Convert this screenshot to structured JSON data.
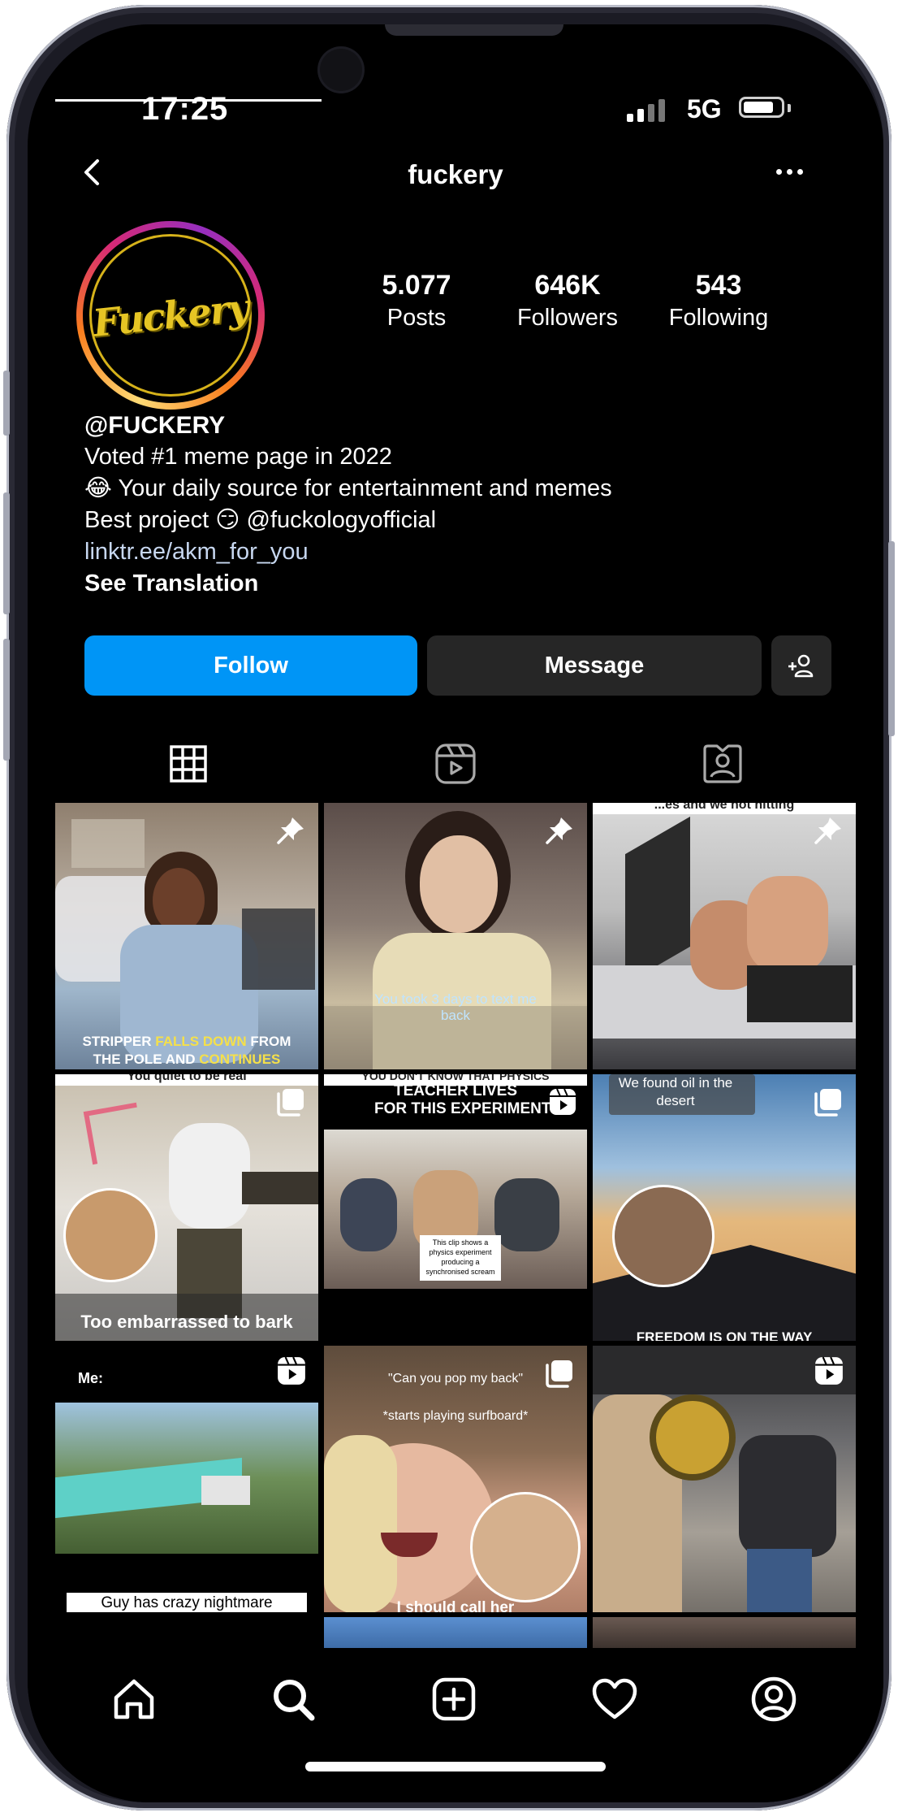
{
  "status_bar": {
    "time": "17:25",
    "network": "5G"
  },
  "header": {
    "username": "fuckery"
  },
  "profile": {
    "avatar_text": "Fuckery",
    "stats": [
      {
        "value": "5.077",
        "label": "Posts"
      },
      {
        "value": "646K",
        "label": "Followers"
      },
      {
        "value": "543",
        "label": "Following"
      }
    ],
    "display_name": "@FUCKERY",
    "bio_line1": "Voted #1 meme page in 2022",
    "bio_line2_emoji": "😂",
    "bio_line2": "Your daily source for entertainment and memes",
    "bio_line3_prefix": "Best project",
    "bio_line3_emoji": "😏",
    "bio_line3_mention": "@fuckologyofficial",
    "link": "linktr.ee/akm_for_you",
    "see_translation": "See Translation"
  },
  "actions": {
    "follow_label": "Follow",
    "message_label": "Message"
  },
  "grid": {
    "p1_caption_a": "STRIPPER ",
    "p1_caption_b": "FALLS DOWN",
    "p1_caption_c": " FROM",
    "p1_caption_d": "THE POLE AND ",
    "p1_caption_e": "CONTINUES",
    "p2_caption": "You took 3 days to text me back",
    "p3_caption_top": "...es and we not hitting",
    "p4_caption_top": "You quiet to be real",
    "p4_caption": "Too embarrassed to bark",
    "p5_caption_top": "YOU DON'T KNOW THAT PHYSICS",
    "p5_caption_l1": "TEACHER LIVES",
    "p5_caption_l2": "FOR THIS EXPERIMENT",
    "p5_inner": "This clip shows a physics experiment producing a synchronised scream",
    "p6_caption_top": "We found oil in the desert",
    "p6_caption_bottom": "FREEDOM IS ON THE WAY",
    "p7_caption_top": "Me:",
    "p7_caption_bottom": "Guy has crazy nightmare",
    "p8_caption_l1": "\"Can you pop my back\"",
    "p8_caption_l2": "*starts playing surfboard*",
    "p8_caption_bottom": "I should call her"
  }
}
